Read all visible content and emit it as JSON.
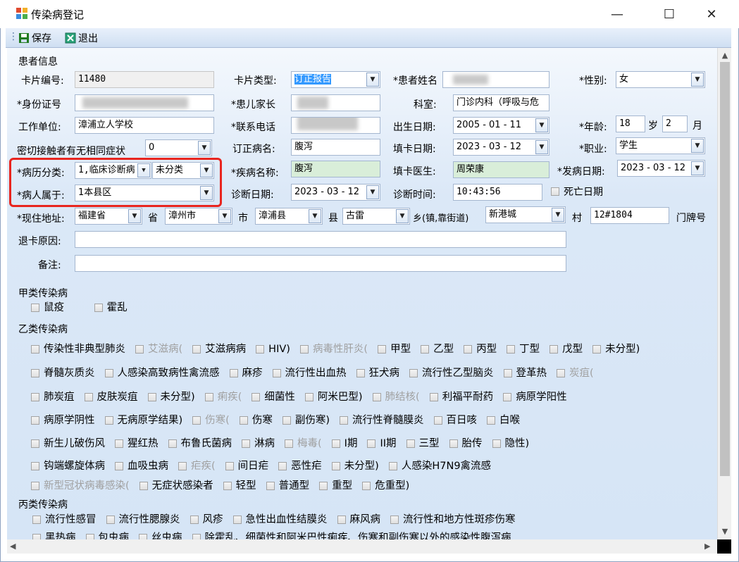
{
  "window": {
    "title": "传染病登记",
    "minimize": "—",
    "maximize": "☐",
    "close": "✕"
  },
  "toolbar": {
    "save": "保存",
    "exit": "退出"
  },
  "patient": {
    "section": "患者信息",
    "card_no_label": "卡片编号:",
    "card_no": "11480",
    "card_type_label": "卡片类型:",
    "card_type": "订正报告",
    "name_label": "患者姓名",
    "gender_label": "性别:",
    "gender": "女",
    "id_label": "身份证号",
    "guardian_label": "患儿家长",
    "dept_label": "科室:",
    "dept": "门诊内科（呼吸与危",
    "work_label": "工作单位:",
    "work": "漳浦立人学校",
    "phone_label": "联系电话",
    "birth_label": "出生日期:",
    "birth": "2005 - 01 - 11",
    "age_label": "年龄:",
    "age_y": "18",
    "age_unit_y": "岁",
    "age_m": "2",
    "age_unit_m": "月",
    "contact_label": "密切接触者有无相同症状",
    "contact": "0",
    "corr_label": "订正病名:",
    "corr": "腹泻",
    "fill_date_label": "填卡日期:",
    "fill_date": "2023 - 03 - 12",
    "job_label": "职业:",
    "job": "学生",
    "history_label": "病历分类:",
    "history1": "1,临床诊断病",
    "history2": "未分类",
    "disease_label": "疾病名称:",
    "disease": "腹泻",
    "doctor_label": "填卡医生:",
    "doctor": "周荣康",
    "onset_label": "发病日期:",
    "onset": "2023 - 03 - 12",
    "belong_label": "病人属于:",
    "belong": "1本县区",
    "diag_date_label": "诊断日期:",
    "diag_date": "2023 - 03 - 12",
    "diag_time_label": "诊断时间:",
    "diag_time": "10:43:56",
    "death_label": "死亡日期",
    "addr_label": "现住地址:",
    "prov": "福建省",
    "prov_u": "省",
    "city": "漳州市",
    "city_u": "市",
    "county": "漳浦县",
    "county_u": "县",
    "town": "古雷",
    "town_u": "乡(镇,靠街道)",
    "village": "新港城",
    "village_u": "村",
    "door": "12#1804",
    "door_u": "门牌号",
    "return_label": "退卡原因:",
    "note_label": "备注:"
  },
  "class_a": {
    "title": "甲类传染病",
    "items": [
      "鼠疫",
      "霍乱"
    ]
  },
  "class_b": {
    "title": "乙类传染病",
    "r1": [
      [
        "传染性非典型肺炎",
        0
      ],
      [
        "艾滋病(",
        1
      ],
      [
        "艾滋病病",
        0
      ],
      [
        "HIV)",
        0
      ],
      [
        "病毒性肝炎(",
        1
      ],
      [
        "甲型",
        0
      ],
      [
        "乙型",
        0
      ],
      [
        "丙型",
        0
      ],
      [
        "丁型",
        0
      ],
      [
        "戊型",
        0
      ],
      [
        "未分型)",
        0
      ]
    ],
    "r2": [
      [
        "脊髓灰质炎",
        0
      ],
      [
        "人感染高致病性禽流感",
        0
      ],
      [
        "麻疹",
        0
      ],
      [
        "流行性出血热",
        0
      ],
      [
        "狂犬病",
        0
      ],
      [
        "流行性乙型脑炎",
        0
      ],
      [
        "登革热",
        0
      ],
      [
        "炭疽(",
        1
      ]
    ],
    "r3": [
      [
        "肺炭疽",
        0
      ],
      [
        "皮肤炭疽",
        0
      ],
      [
        "未分型)",
        0
      ],
      [
        "痢疾(",
        1
      ],
      [
        "细菌性",
        0
      ],
      [
        "阿米巴型)",
        0
      ],
      [
        "肺结核(",
        1
      ],
      [
        "利福平耐药",
        0
      ],
      [
        "病原学阳性",
        0
      ]
    ],
    "r4": [
      [
        "病原学阴性",
        0
      ],
      [
        "无病原学结果)",
        0
      ],
      [
        "伤寒(",
        1
      ],
      [
        "伤寒",
        0
      ],
      [
        "副伤寒)",
        0
      ],
      [
        "流行性脊髓膜炎",
        0
      ],
      [
        "百日咳",
        0
      ],
      [
        "白喉",
        0
      ]
    ],
    "r5": [
      [
        "新生儿破伤风",
        0
      ],
      [
        "猩红热",
        0
      ],
      [
        "布鲁氏菌病",
        0
      ],
      [
        "淋病",
        0
      ],
      [
        "梅毒(",
        1
      ],
      [
        "I期",
        0
      ],
      [
        "II期",
        0
      ],
      [
        "三型",
        0
      ],
      [
        "胎传",
        0
      ],
      [
        "隐性)",
        0
      ]
    ],
    "r6": [
      [
        "钩端螺旋体病",
        0
      ],
      [
        "血吸虫病",
        0
      ],
      [
        "疟疾(",
        1
      ],
      [
        "间日疟",
        0
      ],
      [
        "恶性疟",
        0
      ],
      [
        "未分型)",
        0
      ],
      [
        "人感染H7N9禽流感",
        0
      ]
    ],
    "r7": [
      [
        "新型冠状病毒感染(",
        1
      ],
      [
        "无症状感染者",
        0
      ],
      [
        "轻型",
        0
      ],
      [
        "普通型",
        0
      ],
      [
        "重型",
        0
      ],
      [
        "危重型)",
        0
      ]
    ]
  },
  "class_c": {
    "title": "丙类传染病",
    "r1": [
      [
        "流行性感冒",
        0
      ],
      [
        "流行性腮腺炎",
        0
      ],
      [
        "风疹",
        0
      ],
      [
        "急性出血性结膜炎",
        0
      ],
      [
        "麻风病",
        0
      ],
      [
        "流行性和地方性斑疹伤寒",
        0
      ]
    ],
    "r2": [
      [
        "黑热病",
        0
      ],
      [
        "包虫病",
        0
      ],
      [
        "丝虫病",
        0
      ],
      [
        "除霍乱、细菌性和阿米巴性痢疾、伤寒和副伤寒以外的感染性腹泻病",
        0
      ]
    ]
  },
  "scroll": {
    "up": "▲",
    "down": "▼",
    "left": "◀",
    "right": "▶"
  }
}
